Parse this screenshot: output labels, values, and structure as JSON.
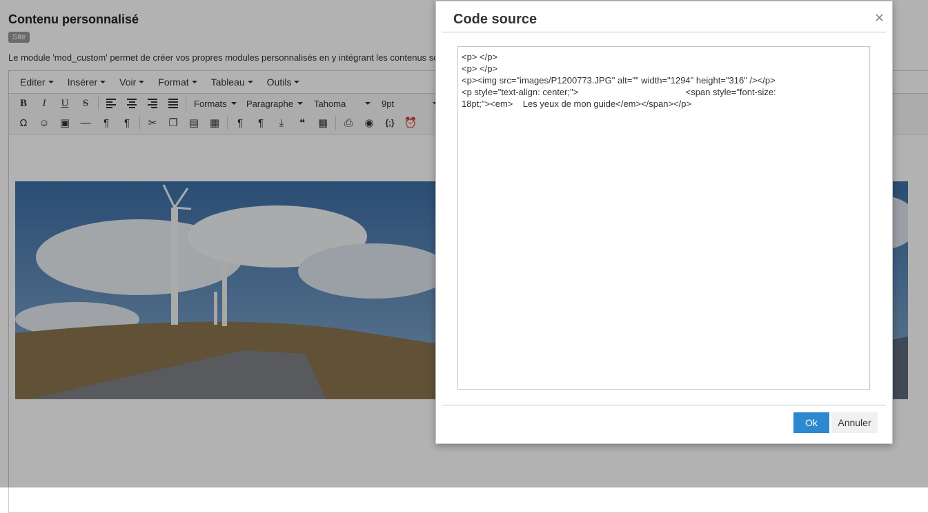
{
  "page": {
    "title": "Contenu personnalisé",
    "badge": "Site",
    "description": "Le module 'mod_custom' permet de créer vos propres modules personnalisés en y intégrant les contenus so"
  },
  "menubar": [
    {
      "label": "Editer"
    },
    {
      "label": "Insérer"
    },
    {
      "label": "Voir"
    },
    {
      "label": "Format"
    },
    {
      "label": "Tableau"
    },
    {
      "label": "Outils"
    }
  ],
  "toolbar": {
    "bold": "B",
    "italic": "I",
    "underline": "U",
    "strike": "S",
    "formats": "Formats",
    "paragraph": "Paragraphe",
    "font": "Tahoma",
    "size": "9pt"
  },
  "icons": [
    "bold-icon",
    "italic-icon",
    "underline-icon",
    "strikethrough-icon",
    "align-left-icon",
    "align-center-icon",
    "align-right-icon",
    "justify-icon",
    "omega-icon",
    "smiley-icon",
    "media-icon",
    "hr-icon",
    "ltr-icon",
    "rtl-icon",
    "cut-icon",
    "copy-icon",
    "paste-icon",
    "paste-text-icon",
    "pilcrow-icon",
    "pilcrow-alt-icon",
    "insert-icon",
    "quote-icon",
    "table-icon",
    "print-icon",
    "preview-icon",
    "code-icon",
    "clock-icon"
  ],
  "dialog": {
    "title": "Code source",
    "close": "×",
    "code_lines": [
      "<p> </p>",
      "<p> </p>",
      "<p><img src=\"images/P1200773.JPG\" alt=\"\" width=\"1294\" height=\"316\" /></p>",
      "<p style=\"text-align: center;\">                                           <span style=\"font-size:",
      "18pt;\"><em>    Les yeux de mon guide</em></span></p>"
    ],
    "ok": "Ok",
    "cancel": "Annuler"
  },
  "colors": {
    "ok_button": "#2d88cf",
    "overlay": "rgba(0,0,0,0.30)"
  }
}
